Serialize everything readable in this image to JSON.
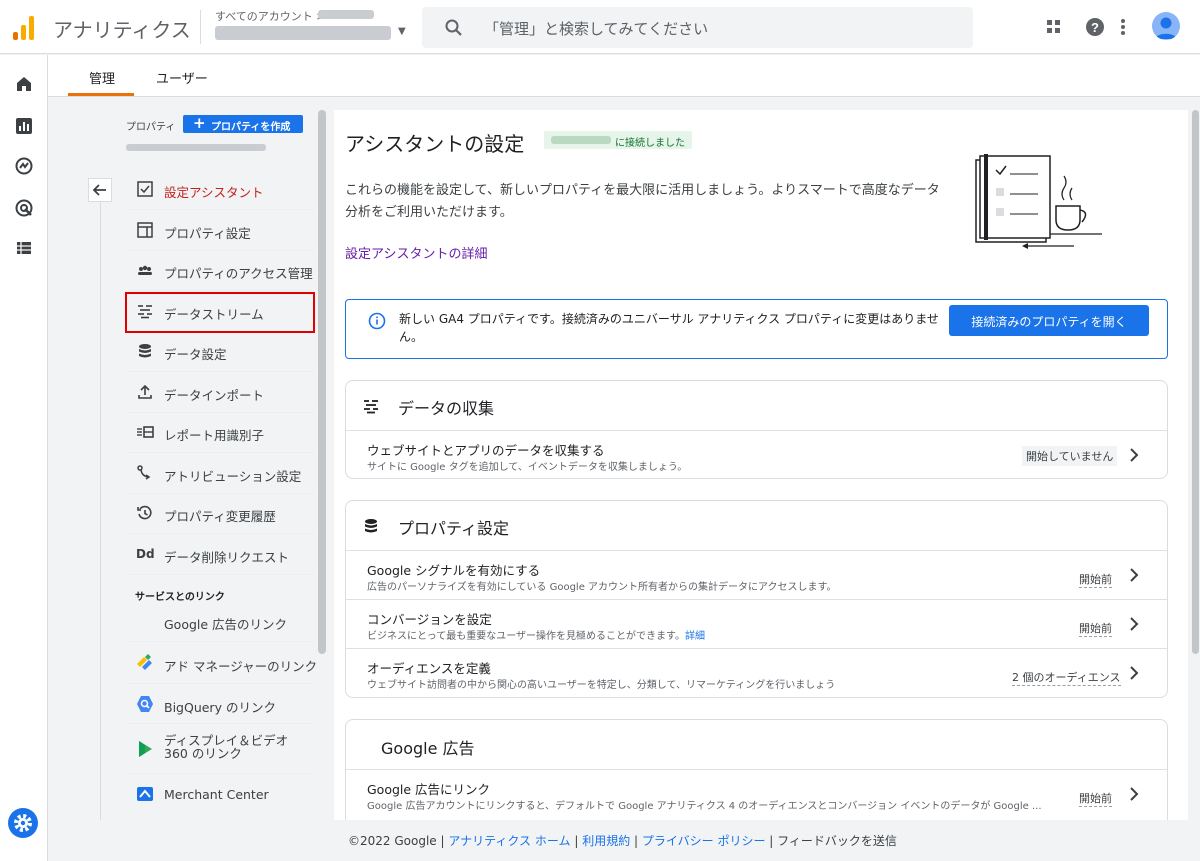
{
  "header": {
    "app_title": "アナリティクス",
    "account_label": "すべてのアカウント >",
    "search_placeholder": "「管理」と検索してみてください",
    "brand_colors": {
      "orange": "#f9ab00",
      "dark_orange": "#e37400",
      "blue": "#1a73e8"
    }
  },
  "tabs": [
    {
      "label": "管理",
      "active": true
    },
    {
      "label": "ユーザー",
      "active": false
    }
  ],
  "nav": {
    "property_label": "プロパティ",
    "create_button": "プロパティを作成",
    "items": [
      {
        "label": "設定アシスタント",
        "icon": "checkbox-icon",
        "active": true
      },
      {
        "label": "プロパティ設定",
        "icon": "layout-icon"
      },
      {
        "label": "プロパティのアクセス管理",
        "icon": "people-icon"
      },
      {
        "label": "データストリーム",
        "icon": "stream-icon"
      },
      {
        "label": "データ設定",
        "icon": "database-icon"
      },
      {
        "label": "データインポート",
        "icon": "upload-icon"
      },
      {
        "label": "レポート用識別子",
        "icon": "identifier-icon"
      },
      {
        "label": "アトリビューション設定",
        "icon": "attribution-icon"
      },
      {
        "label": "プロパティ変更履歴",
        "icon": "history-icon"
      },
      {
        "label": "データ削除リクエスト",
        "icon": "dd-icon"
      }
    ],
    "links_heading": "サービスとのリンク",
    "links": [
      {
        "label": "Google 広告のリンク",
        "icon": ""
      },
      {
        "label": "アド マネージャーのリンク",
        "icon": "ad-manager-icon"
      },
      {
        "label": "BigQuery のリンク",
        "icon": "bigquery-icon"
      },
      {
        "label": "ディスプレイ＆ビデオ 360 のリンク",
        "icon": "dv360-icon"
      },
      {
        "label": "Merchant Center",
        "icon": "merchant-center-icon"
      }
    ]
  },
  "main": {
    "title": "アシスタントの設定",
    "connected_badge": "に接続しました",
    "intro": "これらの機能を設定して、新しいプロパティを最大限に活用しましょう。よりスマートで高度なデータ分析をご利用いただけます。",
    "details_link": "設定アシスタントの詳細",
    "notice": {
      "text": "新しい GA4 プロパティです。接続済みのユニバーサル アナリティクス プロパティに変更はありません。",
      "button": "接続済みのプロパティを開く"
    },
    "cards": [
      {
        "title": "データの収集",
        "icon": "stream-icon",
        "rows": [
          {
            "title": "ウェブサイトとアプリのデータを収集する",
            "desc": "サイトに Google タグを追加して、イベントデータを収集しましょう。",
            "status": "開始していません"
          }
        ]
      },
      {
        "title": "プロパティ設定",
        "icon": "database-icon",
        "rows": [
          {
            "title": "Google シグナルを有効にする",
            "desc": "広告のパーソナライズを有効にしている Google アカウント所有者からの集計データにアクセスします。",
            "status": "開始前"
          },
          {
            "title": "コンバージョンを設定",
            "desc": "ビジネスにとって最も重要なユーザー操作を見極めることができます。",
            "desc_link": "詳細",
            "status": "開始前"
          },
          {
            "title": "オーディエンスを定義",
            "desc": "ウェブサイト訪問者の中から関心の高いユーザーを特定し、分類して、リマーケティングを行いましょう",
            "status": "2 個のオーディエンス"
          }
        ]
      },
      {
        "title": "Google 広告",
        "icon": "",
        "rows": [
          {
            "title": "Google 広告にリンク",
            "desc": "Google 広告アカウントにリンクすると、デフォルトで Google アナリティクス 4 のオーディエンスとコンバージョン イベントのデータが Google ...",
            "status": "開始前"
          }
        ]
      }
    ]
  },
  "footer": {
    "copyright": "©2022 Google",
    "links": [
      "アナリティクス ホーム",
      "利用規約",
      "プライバシー ポリシー"
    ],
    "feedback": "フィードバックを送信"
  }
}
